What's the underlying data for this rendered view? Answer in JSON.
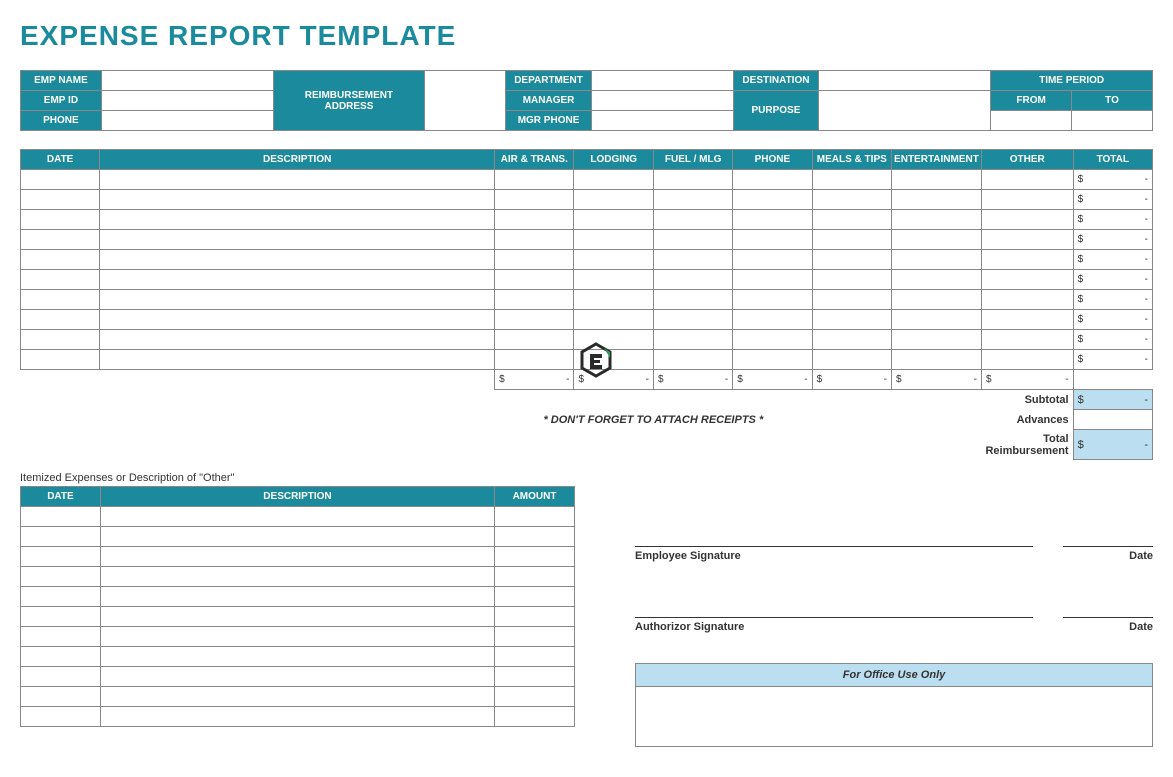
{
  "title": "EXPENSE REPORT TEMPLATE",
  "info": {
    "emp_name": "EMP NAME",
    "emp_id": "EMP ID",
    "phone": "PHONE",
    "reimb_addr": "REIMBURSEMENT ADDRESS",
    "department": "DEPARTMENT",
    "manager": "MANAGER",
    "mgr_phone": "MGR PHONE",
    "destination": "DESTINATION",
    "purpose": "PURPOSE",
    "time_period": "TIME PERIOD",
    "from": "FROM",
    "to": "TO"
  },
  "main_cols": {
    "date": "DATE",
    "description": "DESCRIPTION",
    "air": "AIR & TRANS.",
    "lodging": "LODGING",
    "fuel": "FUEL / MLG",
    "phone": "PHONE",
    "meals": "MEALS & TIPS",
    "ent": "ENTERTAINMENT",
    "other": "OTHER",
    "total": "TOTAL"
  },
  "currency": "$",
  "dash": "-",
  "summary": {
    "subtotal": "Subtotal",
    "advances": "Advances",
    "total_reimb": "Total Reimbursement"
  },
  "receipts_msg": "* DON'T FORGET TO ATTACH RECEIPTS *",
  "itemized_title": "Itemized Expenses or Description of \"Other\"",
  "itemized_cols": {
    "date": "DATE",
    "description": "DESCRIPTION",
    "amount": "AMOUNT"
  },
  "sig": {
    "employee": "Employee Signature",
    "authorizor": "Authorizor Signature",
    "date": "Date"
  },
  "office": "For Office Use Only"
}
